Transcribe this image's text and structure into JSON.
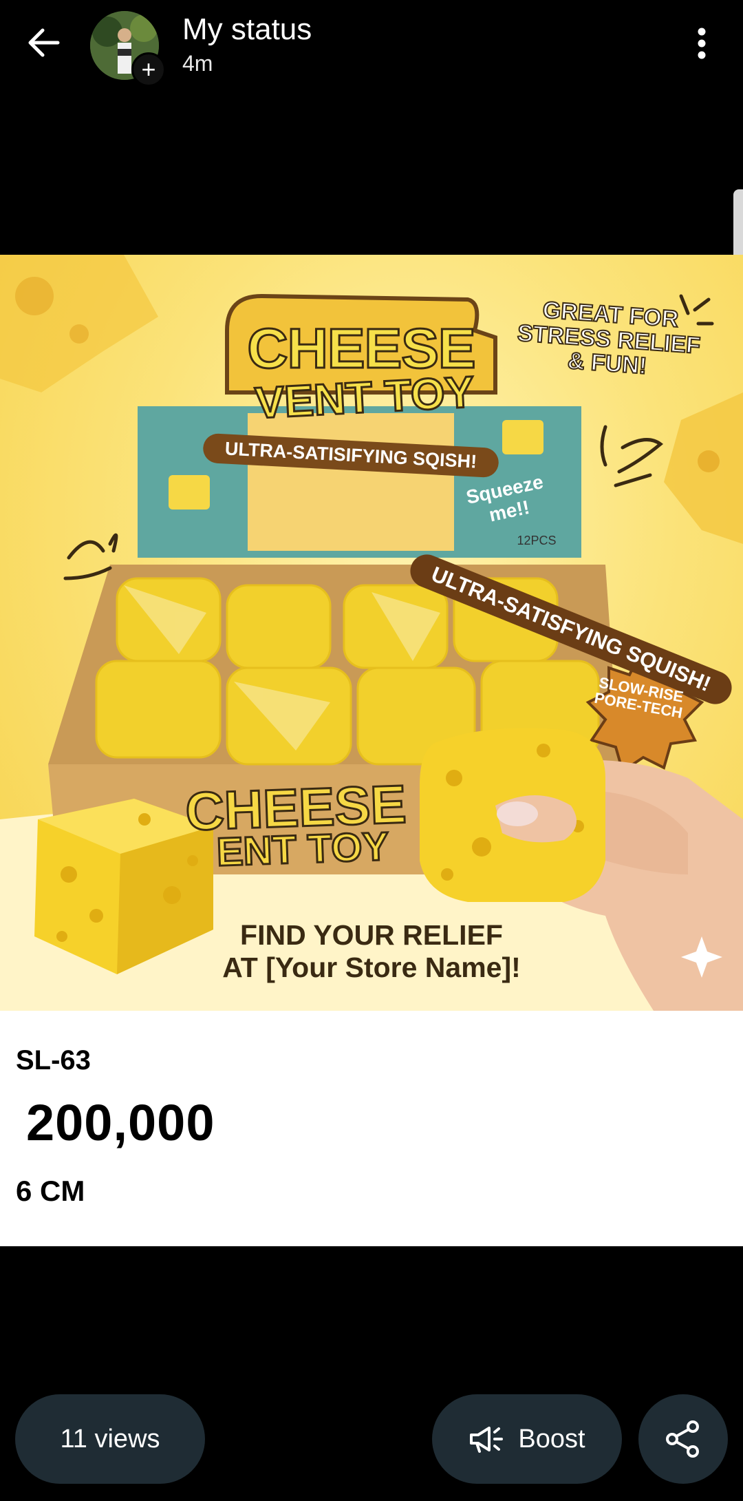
{
  "header": {
    "title": "My status",
    "time": "4m",
    "add_symbol": "+"
  },
  "poster": {
    "title_line1": "CHEESE",
    "title_line2": "VENT TOY",
    "great_for": "GREAT FOR STRESS RELIEF & FUN!",
    "ultra_box": "ULTRA-SATISIFYING SQISH!",
    "squeeze": "Squeeze me!!",
    "pcs": "12PCS",
    "ultra_banner": "ULTRA-SATISFYING SQUISH!",
    "badge": "SLOW-RISE PORE-TECH",
    "box_front_line1": "CHEESE",
    "box_front_line2": "ENT TOY",
    "find_line1": "FIND YOUR RELIEF",
    "find_line2": "AT [Your Store Name]!"
  },
  "caption": {
    "code": "SL-63",
    "price": "200,000",
    "size": "6 CM"
  },
  "footer": {
    "views": "11 views",
    "boost": "Boost"
  },
  "colors": {
    "background": "#000000",
    "pill": "#1f2c34",
    "caption_bg": "#ffffff",
    "cheese": "#f6d845"
  },
  "icons": [
    "back-arrow-icon",
    "plus-icon",
    "more-vert-icon",
    "sparkle-icon",
    "megaphone-icon",
    "share-icon"
  ]
}
